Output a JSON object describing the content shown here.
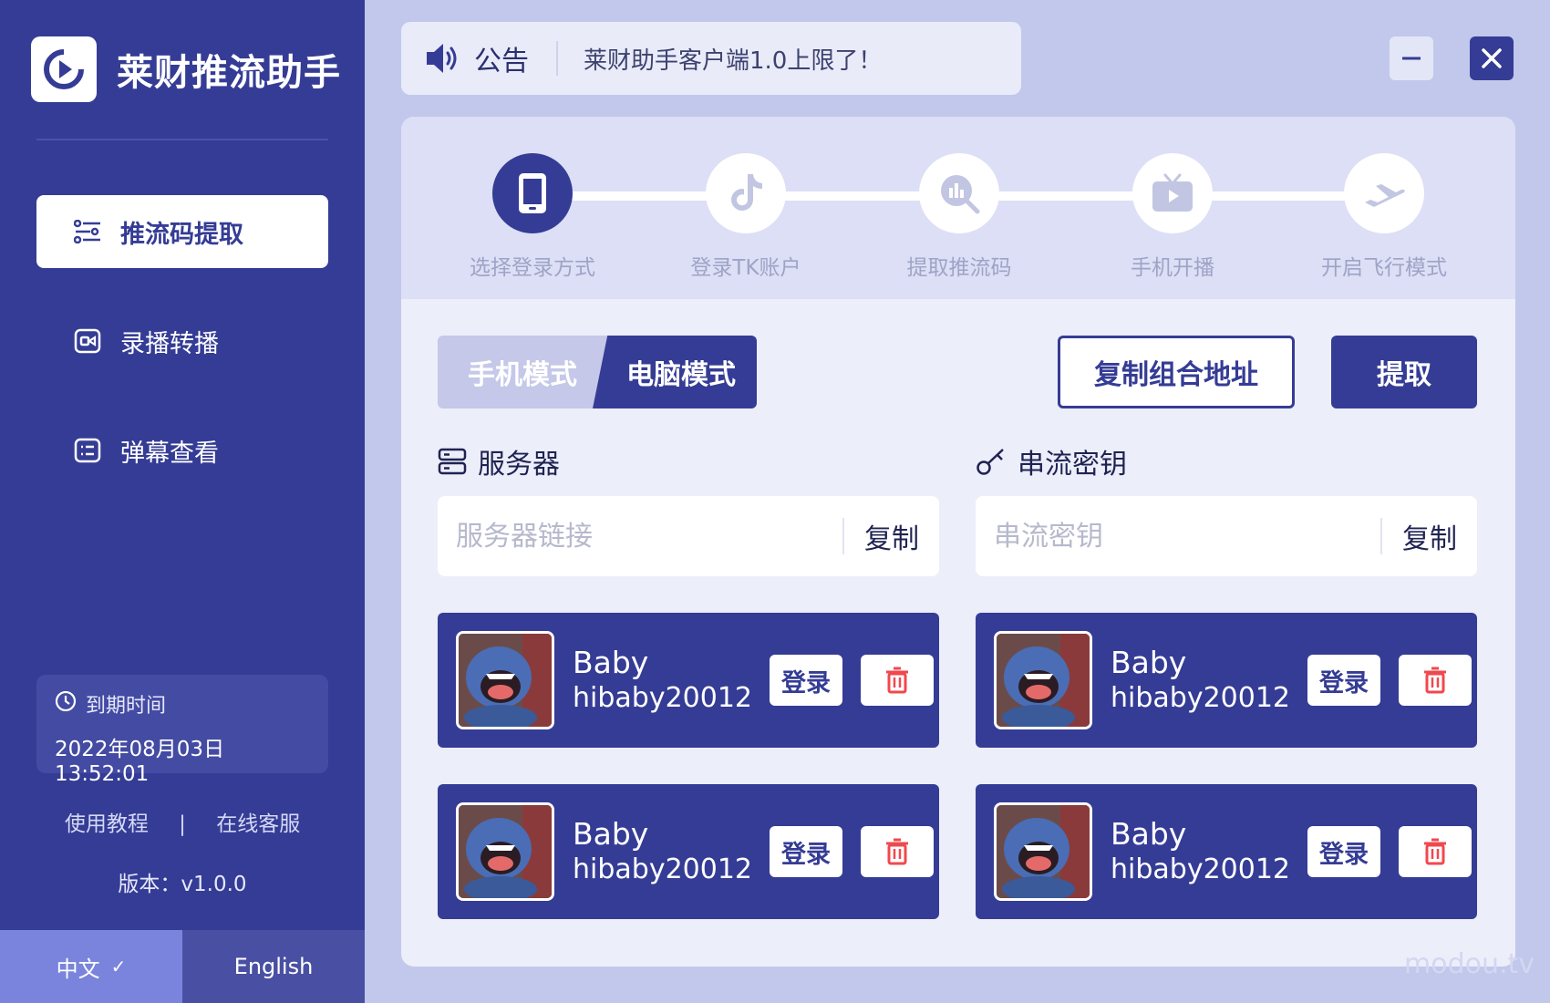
{
  "app": {
    "title": "莱财推流助手"
  },
  "sidebar": {
    "items": [
      {
        "label": "推流码提取",
        "icon": "settings-list-icon",
        "active": true
      },
      {
        "label": "录播转播",
        "icon": "record-icon",
        "active": false
      },
      {
        "label": "弹幕查看",
        "icon": "comment-icon",
        "active": false
      }
    ],
    "expiry": {
      "label": "到期时间",
      "value": "2022年08月03日 13:52:01"
    },
    "links": {
      "tutorial": "使用教程",
      "separator": "|",
      "support": "在线客服"
    },
    "version": "版本：v1.0.0",
    "lang": {
      "zh": "中文",
      "en": "English",
      "selected": "zh"
    }
  },
  "notice": {
    "label": "公告",
    "text": "莱财助手客户端1.0上限了！"
  },
  "steps": [
    {
      "label": "选择登录方式",
      "icon": "phone-icon",
      "active": true
    },
    {
      "label": "登录TK账户",
      "icon": "tiktok-icon",
      "active": false
    },
    {
      "label": "提取推流码",
      "icon": "chart-search-icon",
      "active": false
    },
    {
      "label": "手机开播",
      "icon": "tv-icon",
      "active": false
    },
    {
      "label": "开启飞行模式",
      "icon": "airplane-icon",
      "active": false
    }
  ],
  "modes": {
    "phone": "手机模式",
    "pc": "电脑模式",
    "selected": "pc"
  },
  "actions": {
    "copy_combo": "复制组合地址",
    "extract": "提取"
  },
  "server": {
    "title": "服务器",
    "placeholder": "服务器链接",
    "value": "",
    "copy": "复制"
  },
  "stream_key": {
    "title": "串流密钥",
    "placeholder": "串流密钥",
    "value": "",
    "copy": "复制"
  },
  "accounts": [
    {
      "name": "Baby",
      "id": "hibaby20012",
      "login": "登录"
    },
    {
      "name": "Baby",
      "id": "hibaby20012",
      "login": "登录"
    },
    {
      "name": "Baby",
      "id": "hibaby20012",
      "login": "登录"
    },
    {
      "name": "Baby",
      "id": "hibaby20012",
      "login": "登录"
    }
  ],
  "watermark": "modou.tv",
  "colors": {
    "primary": "#353c95",
    "accent": "#7a84dc",
    "danger": "#f0484e",
    "background": "#c2c8ec"
  }
}
